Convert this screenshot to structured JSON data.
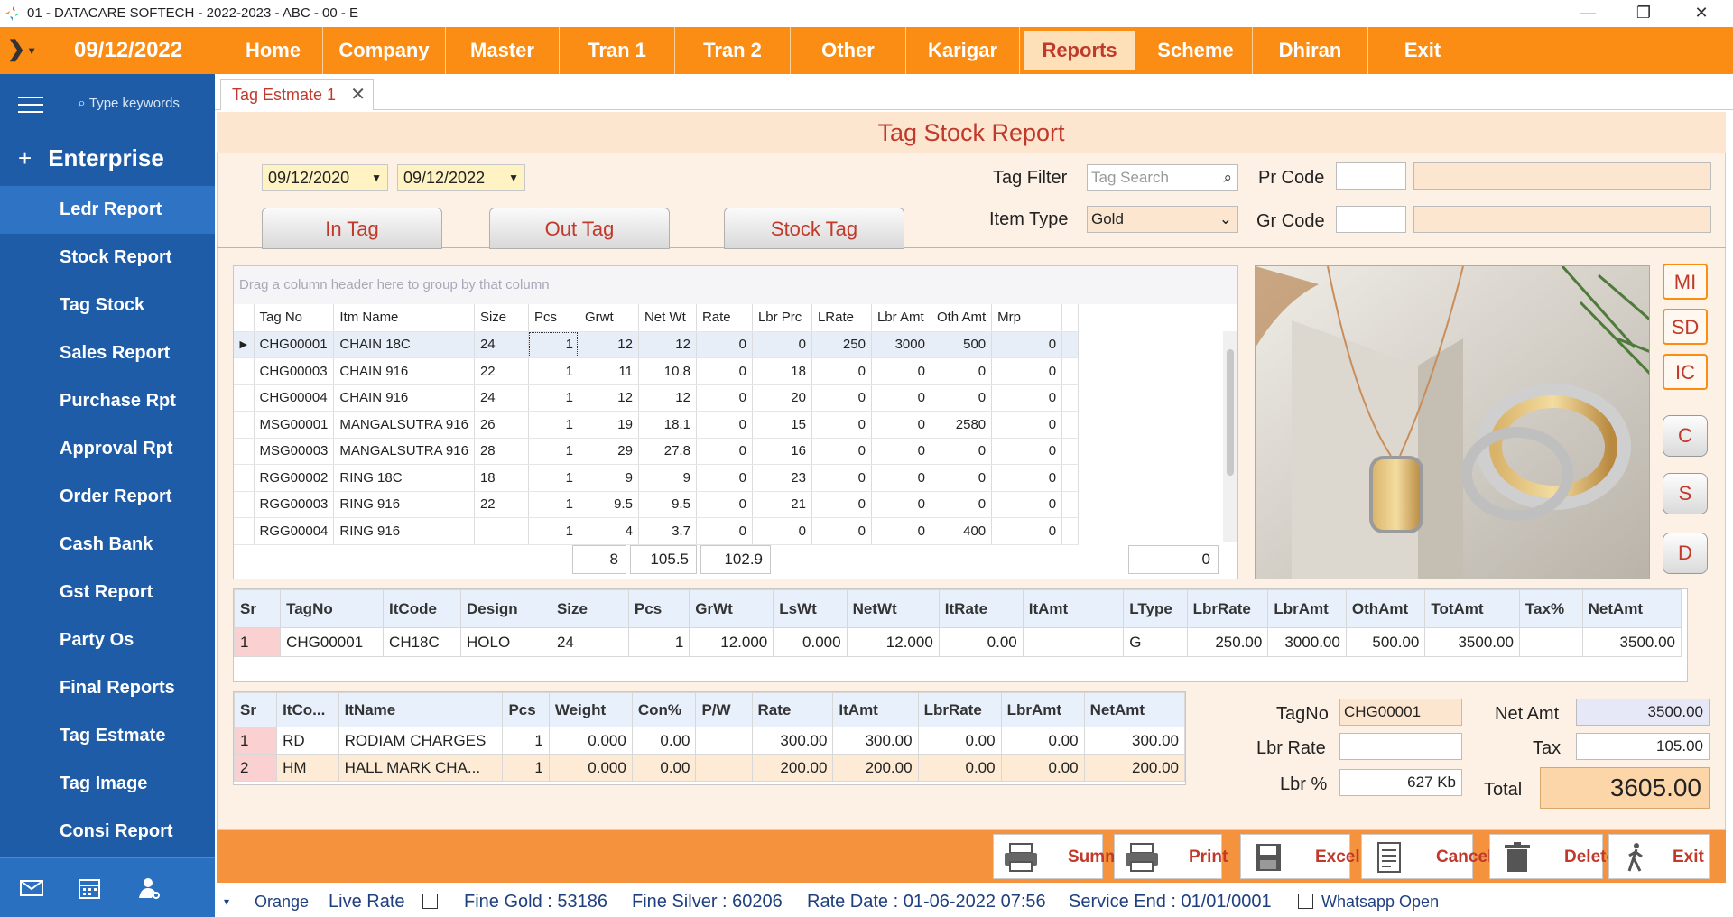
{
  "window": {
    "title": "01 - DATACARE SOFTECH - 2022-2023 - ABC - 00 - E",
    "minimize": "—",
    "restore": "❐",
    "close": "✕"
  },
  "menubar": {
    "date": "09/12/2022",
    "items": [
      "Home",
      "Company",
      "Master",
      "Tran 1",
      "Tran 2",
      "Other",
      "Karigar",
      "Reports",
      "Scheme",
      "Dhiran",
      "Exit"
    ],
    "active": "Reports"
  },
  "sidebar": {
    "search_placeholder": "Type keywords",
    "section": "Enterprise",
    "items": [
      "Ledr Report",
      "Stock Report",
      "Tag Stock",
      "Sales Report",
      "Purchase Rpt",
      "Approval Rpt",
      "Order Report",
      "Cash Bank",
      "Gst Report",
      "Party Os",
      "Final Reports",
      "Tag Estmate",
      "Tag Image",
      "Consi Report"
    ],
    "active": "Ledr Report"
  },
  "tab": {
    "label": "Tag Estmate 1",
    "close": "✕"
  },
  "report": {
    "title": "Tag Stock Report",
    "from_date": "09/12/2020",
    "to_date": "09/12/2022",
    "buttons": {
      "in_tag": "In Tag",
      "out_tag": "Out Tag",
      "stock_tag": "Stock Tag"
    },
    "tag_filter_label": "Tag Filter",
    "tag_search_placeholder": "Tag Search",
    "item_type_label": "Item Type",
    "item_type_value": "Gold",
    "pr_code_label": "Pr Code",
    "gr_code_label": "Gr Code"
  },
  "grid1": {
    "group_hint": "Drag a column header here to group by that column",
    "columns": [
      "Tag No",
      "Itm Name",
      "Size",
      "Pcs",
      "Grwt",
      "Net Wt",
      "Rate",
      "Lbr Prc",
      "LRate",
      "Lbr Amt",
      "Oth Amt",
      "Mrp"
    ],
    "rows": [
      [
        "CHG00001",
        "CHAIN 18C",
        "24",
        "1",
        "12",
        "12",
        "0",
        "0",
        "250",
        "3000",
        "500",
        "0"
      ],
      [
        "CHG00003",
        "CHAIN 916",
        "22",
        "1",
        "11",
        "10.8",
        "0",
        "18",
        "0",
        "0",
        "0",
        "0"
      ],
      [
        "CHG00004",
        "CHAIN 916",
        "24",
        "1",
        "12",
        "12",
        "0",
        "20",
        "0",
        "0",
        "0",
        "0"
      ],
      [
        "MSG00001",
        "MANGALSUTRA 916",
        "26",
        "1",
        "19",
        "18.1",
        "0",
        "15",
        "0",
        "0",
        "2580",
        "0"
      ],
      [
        "MSG00003",
        "MANGALSUTRA 916",
        "28",
        "1",
        "29",
        "27.8",
        "0",
        "16",
        "0",
        "0",
        "0",
        "0"
      ],
      [
        "RGG00002",
        "RING 18C",
        "18",
        "1",
        "9",
        "9",
        "0",
        "23",
        "0",
        "0",
        "0",
        "0"
      ],
      [
        "RGG00003",
        "RING 916",
        "22",
        "1",
        "9.5",
        "9.5",
        "0",
        "21",
        "0",
        "0",
        "0",
        "0"
      ],
      [
        "RGG00004",
        "RING 916",
        "",
        "1",
        "4",
        "3.7",
        "0",
        "0",
        "0",
        "0",
        "400",
        "0"
      ]
    ],
    "totals": {
      "pcs": "8",
      "grwt": "105.5",
      "netwt": "102.9",
      "mrp": "0"
    }
  },
  "side_buttons": [
    "MI",
    "SD",
    "IC",
    "C",
    "S",
    "D"
  ],
  "grid2": {
    "columns": [
      "Sr",
      "TagNo",
      "ItCode",
      "Design",
      "Size",
      "Pcs",
      "GrWt",
      "LsWt",
      "NetWt",
      "ItRate",
      "ItAmt",
      "LType",
      "LbrRate",
      "LbrAmt",
      "OthAmt",
      "TotAmt",
      "Tax%",
      "NetAmt"
    ],
    "rows": [
      [
        "1",
        "CHG00001",
        "CH18C",
        "HOLO",
        "24",
        "1",
        "12.000",
        "0.000",
        "12.000",
        "0.00",
        "",
        "G",
        "250.00",
        "3000.00",
        "500.00",
        "3500.00",
        "",
        "3500.00"
      ]
    ]
  },
  "grid3": {
    "columns": [
      "Sr",
      "ItCo...",
      "ItName",
      "Pcs",
      "Weight",
      "Con%",
      "P/W",
      "Rate",
      "ItAmt",
      "LbrRate",
      "LbrAmt",
      "NetAmt"
    ],
    "rows": [
      [
        "1",
        "RD",
        "RODIAM CHARGES",
        "1",
        "0.000",
        "0.00",
        "",
        "300.00",
        "300.00",
        "0.00",
        "0.00",
        "300.00"
      ],
      [
        "2",
        "HM",
        "HALL MARK CHA...",
        "1",
        "0.000",
        "0.00",
        "",
        "200.00",
        "200.00",
        "0.00",
        "0.00",
        "200.00"
      ]
    ]
  },
  "summary": {
    "tagno_label": "TagNo",
    "tagno": "CHG00001",
    "lbr_rate_label": "Lbr Rate",
    "lbr_rate": "",
    "lbr_pct_label": "Lbr %",
    "lbr_pct": "627 Kb",
    "net_amt_label": "Net Amt",
    "net_amt": "3500.00",
    "tax_label": "Tax",
    "tax": "105.00",
    "total_label": "Total",
    "total": "3605.00"
  },
  "toolbar": {
    "summ": "Summ",
    "print": "Print",
    "excel": "Excel",
    "cancel": "Cancel",
    "delete": "Delete",
    "exit": "Exit"
  },
  "status": {
    "theme": "Orange",
    "live_rate": "Live Rate",
    "fine_gold": "Fine Gold : 53186",
    "fine_silver": "Fine Silver : 60206",
    "rate_date": "Rate Date : 01-06-2022 07:56",
    "service_end": "Service End :  01/01/0001",
    "whatsapp": "Whatsapp Open"
  },
  "colors": {
    "accent": "#fb8c14",
    "sidebar": "#1e5ca8",
    "title_red": "#c0392b"
  }
}
